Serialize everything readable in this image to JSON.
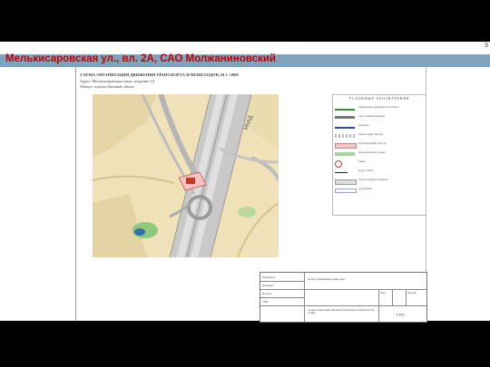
{
  "slide": {
    "title": "Мелькисаровская ул., вл. 2А, САО Молжаниновский",
    "page_number": "9"
  },
  "sheet": {
    "heading": "СХЕМА ОРГАНИЗАЦИИ ДВИЖЕНИЯ ТРАНСПОРТА И ПЕШЕХОДОВ, М 1 :2000",
    "address": "Адрес: Мелькисаровская улица, владение 2А",
    "object": "Объект: торгово-бытовой объект",
    "road_label": "МКАД"
  },
  "legend": {
    "title": "УСЛОВНЫЕ ОБОЗНАЧЕНИЯ",
    "items": [
      {
        "text": "направление движения транспорта",
        "color": "#3a8a3a"
      },
      {
        "text": "зона стоянки/парковки",
        "color": "#777777"
      },
      {
        "text": "разметка",
        "color": "#2b4d9e"
      },
      {
        "text": "пешеходный переход",
        "color": "#bbbbbb"
      },
      {
        "text": "проектируемый тротуар",
        "color": "#f3c6c6"
      },
      {
        "text": "проектируемые газоны",
        "color": "#a9d49b"
      },
      {
        "text": "знаки",
        "color": "#c84040"
      },
      {
        "text": "въезд / выезд",
        "color": "#222222"
      },
      {
        "text": "существующее покрытие",
        "color": "#dddddd"
      },
      {
        "text": "ограждение",
        "color": "#9aa8c8"
      }
    ]
  },
  "stamp": {
    "rows": [
      "Разработал",
      "Проверил",
      "Н.контр.",
      "ГИП"
    ],
    "project": "Проект планировки территории",
    "description": "Схема организации движения транспорта и пешеходов М 1:2000",
    "sheet": "Лист",
    "sheets": "Листов",
    "org": "ГУП"
  }
}
